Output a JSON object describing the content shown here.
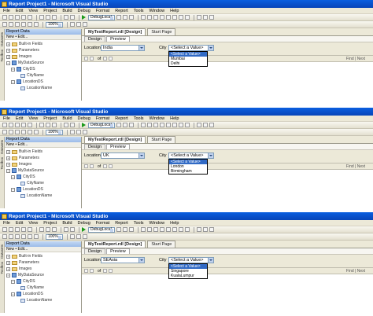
{
  "window": {
    "title": "Report Project1 - Microsoft Visual Studio"
  },
  "menu": [
    "File",
    "Edit",
    "View",
    "Project",
    "Build",
    "Debug",
    "Format",
    "Report",
    "Tools",
    "Window",
    "Help"
  ],
  "toolbar": {
    "config_label": "DebugLocal",
    "zoom_label": "100%"
  },
  "side_tabs": [
    "Datasets",
    "Toolbox"
  ],
  "report_data": {
    "title": "Report Data",
    "toolbar_label": "New • Edit...",
    "tree": [
      {
        "label": "Built-in Fields",
        "kind": "folder"
      },
      {
        "label": "Parameters",
        "kind": "folder"
      },
      {
        "label": "Images",
        "kind": "folder"
      },
      {
        "label": "MyDataSource",
        "kind": "datasource"
      },
      {
        "label": "CityDS",
        "kind": "dataset"
      },
      {
        "label": "CityName",
        "kind": "field"
      },
      {
        "label": "LocationDS",
        "kind": "dataset"
      },
      {
        "label": "LocationName",
        "kind": "field"
      }
    ]
  },
  "document_tabs": [
    "MyTestReport.rdl [Design]",
    "Start Page"
  ],
  "view_tabs": [
    "Design",
    "Preview"
  ],
  "parameters": {
    "location_label": "Location",
    "city_label": "City"
  },
  "report_toolbar": {
    "page_of": "of",
    "find_label": "Find | Next"
  },
  "panels": [
    {
      "location_value": "India",
      "city_value": "<Select a Value>",
      "dropdown_items": [
        "<Select a Value>",
        "Mumbai",
        "Delhi"
      ]
    },
    {
      "location_value": "UK",
      "city_value": "<Select a Value>",
      "dropdown_items": [
        "<Select a Value>",
        "London",
        "Birmingham"
      ]
    },
    {
      "location_value": "SEAsia",
      "city_value": "<Select a Value>",
      "dropdown_items": [
        "<Select a Value>",
        "Singapore",
        "KualaLumpur"
      ]
    }
  ]
}
